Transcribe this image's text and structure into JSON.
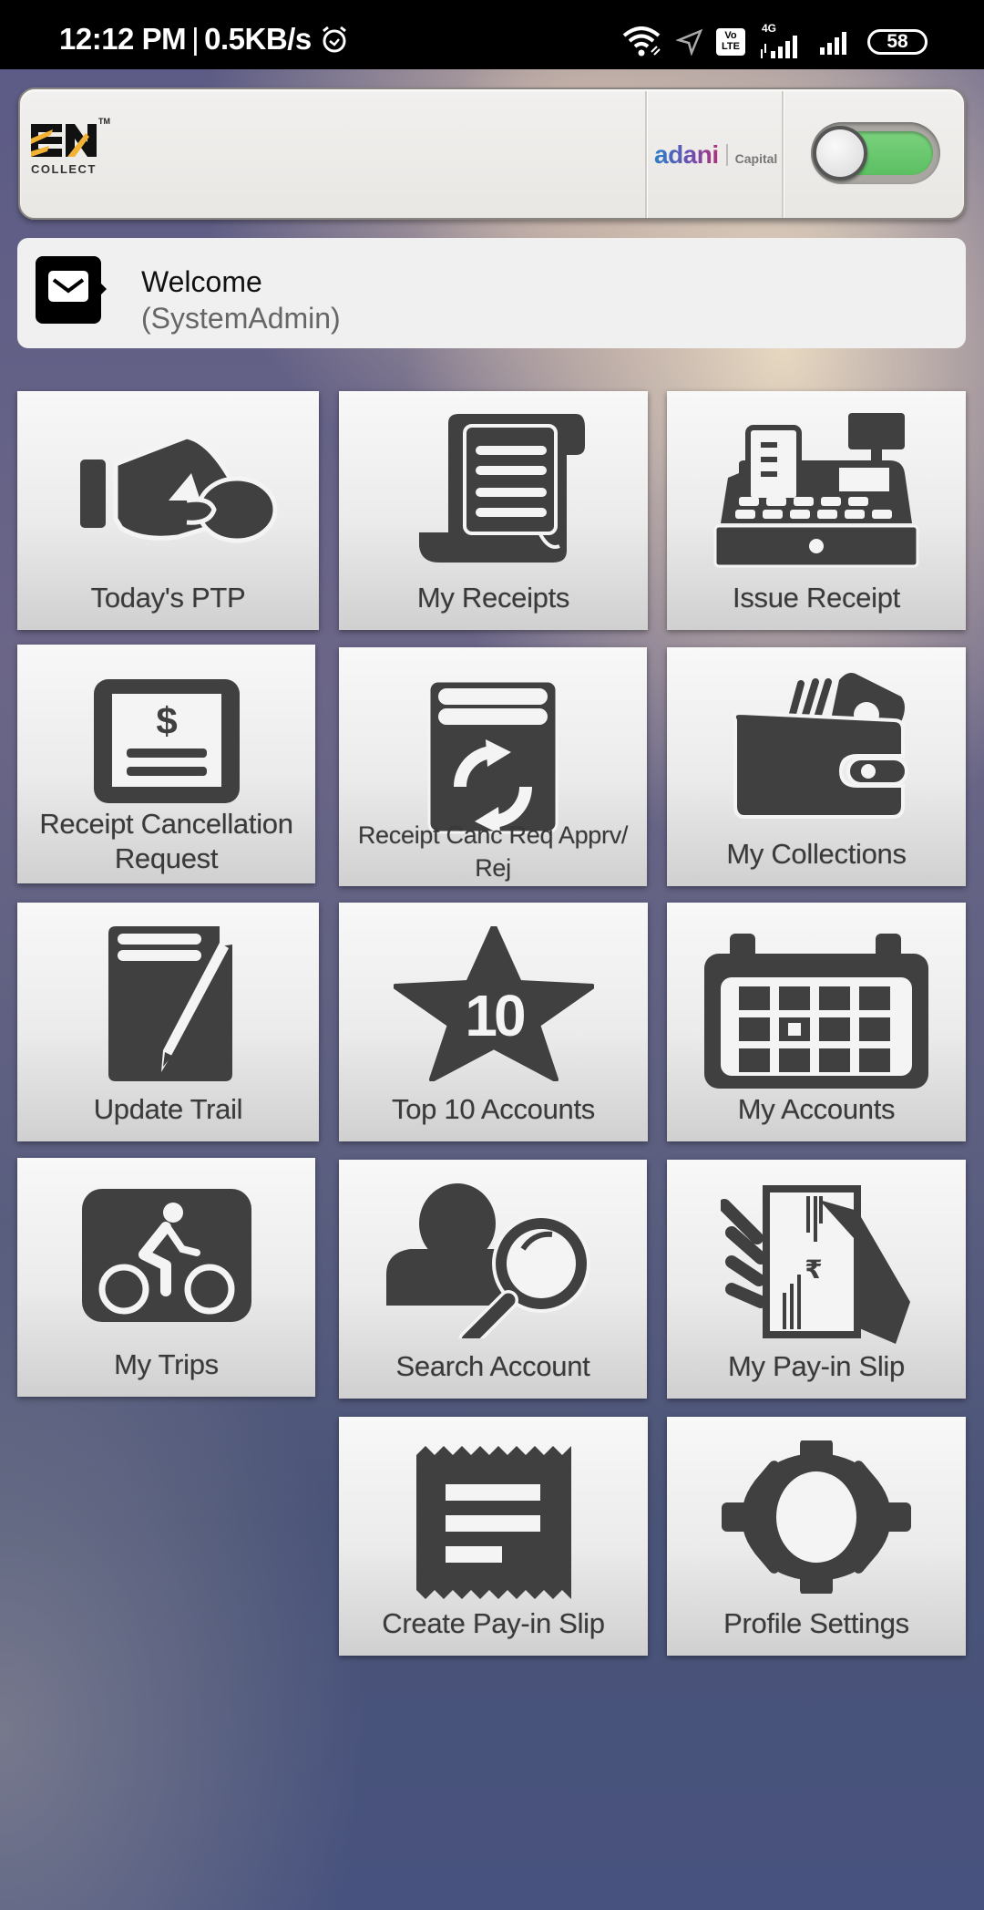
{
  "status_bar": {
    "time": "12:12 PM",
    "network_speed": "0.5KB/s",
    "separator": "|",
    "volte_top": "Vo",
    "volte_bottom": "LTE",
    "network_type": "4G",
    "battery": "58",
    "icons": [
      "alarm-icon",
      "wifi-icon",
      "location-icon",
      "volte-icon",
      "signal-icon",
      "signal-icon",
      "battery-icon"
    ]
  },
  "header": {
    "logo_text": "EN",
    "logo_tm": "TM",
    "logo_sub": "COLLECT",
    "partner_brand": "adani",
    "partner_sub": "Capital",
    "toggle_on": true,
    "toggle_color": "#5cbf62"
  },
  "welcome": {
    "title": "Welcome",
    "user": "(SystemAdmin)"
  },
  "menu": {
    "tiles": [
      {
        "label": "Today's PTP",
        "icon": "hand-coin-icon"
      },
      {
        "label": "My Receipts",
        "icon": "receipt-scroll-icon"
      },
      {
        "label": "Issue Receipt",
        "icon": "cash-register-icon"
      },
      {
        "label": "Receipt Cancellation Request",
        "line1": "Receipt Cancellation",
        "line2": "Request",
        "icon": "dollar-document-icon"
      },
      {
        "label": "Receipt Canc Req Apprv/ Rej",
        "line1": "Receipt Canc Req Apprv/",
        "line2": "Rej",
        "icon": "refresh-document-icon"
      },
      {
        "label": "My Collections",
        "icon": "wallet-icon"
      },
      {
        "label": "Update Trail",
        "icon": "pencil-document-icon"
      },
      {
        "label": "Top 10 Accounts",
        "icon": "star-10-icon",
        "badge": "10"
      },
      {
        "label": "My Accounts",
        "icon": "calendar-icon"
      },
      {
        "label": "My Trips",
        "icon": "bicycle-icon"
      },
      {
        "label": "Search Account",
        "icon": "user-search-icon"
      },
      {
        "label": "My Pay-in Slip",
        "icon": "hand-cheque-icon",
        "symbol": "₹"
      },
      {
        "label": "Create Pay-in Slip",
        "icon": "slip-icon"
      },
      {
        "label": "Profile Settings",
        "icon": "gear-icon"
      }
    ]
  }
}
